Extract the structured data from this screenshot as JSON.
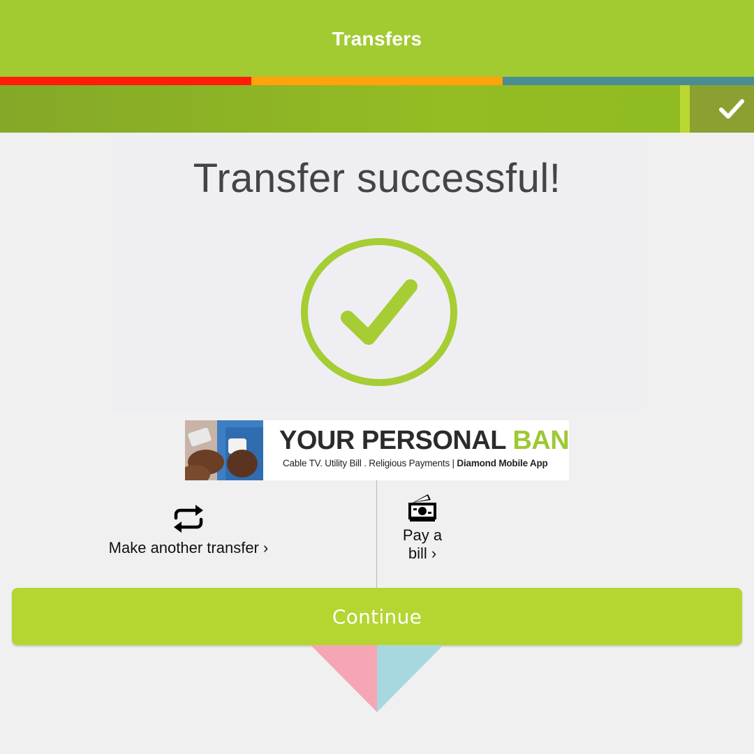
{
  "header": {
    "title": "Transfers"
  },
  "colors": {
    "brand_green": "#a2cb31",
    "button_green": "#b5d531",
    "stripe_red": "#ff1d0a",
    "stripe_orange": "#ffa30c",
    "stripe_teal": "#4b8c93",
    "check_green": "#a6cd34"
  },
  "progress": {
    "status": "complete",
    "icon": "checkmark-icon"
  },
  "success": {
    "title": "Transfer successful!",
    "icon": "check-circle-icon"
  },
  "banner": {
    "headline_dark": "YOUR PERSONAL",
    "headline_green": "BANK",
    "sub_regular": "Cable TV. Utility Bill . Religious Payments | ",
    "sub_bold": "Diamond Mobile App"
  },
  "actions": {
    "another_transfer": {
      "label": "Make another transfer ›",
      "icon": "repeat-icon"
    },
    "pay_bill": {
      "label_line1": "Pay a",
      "label_line2": "bill ›",
      "icon": "money-icon"
    }
  },
  "continue": {
    "label": "Continue"
  }
}
